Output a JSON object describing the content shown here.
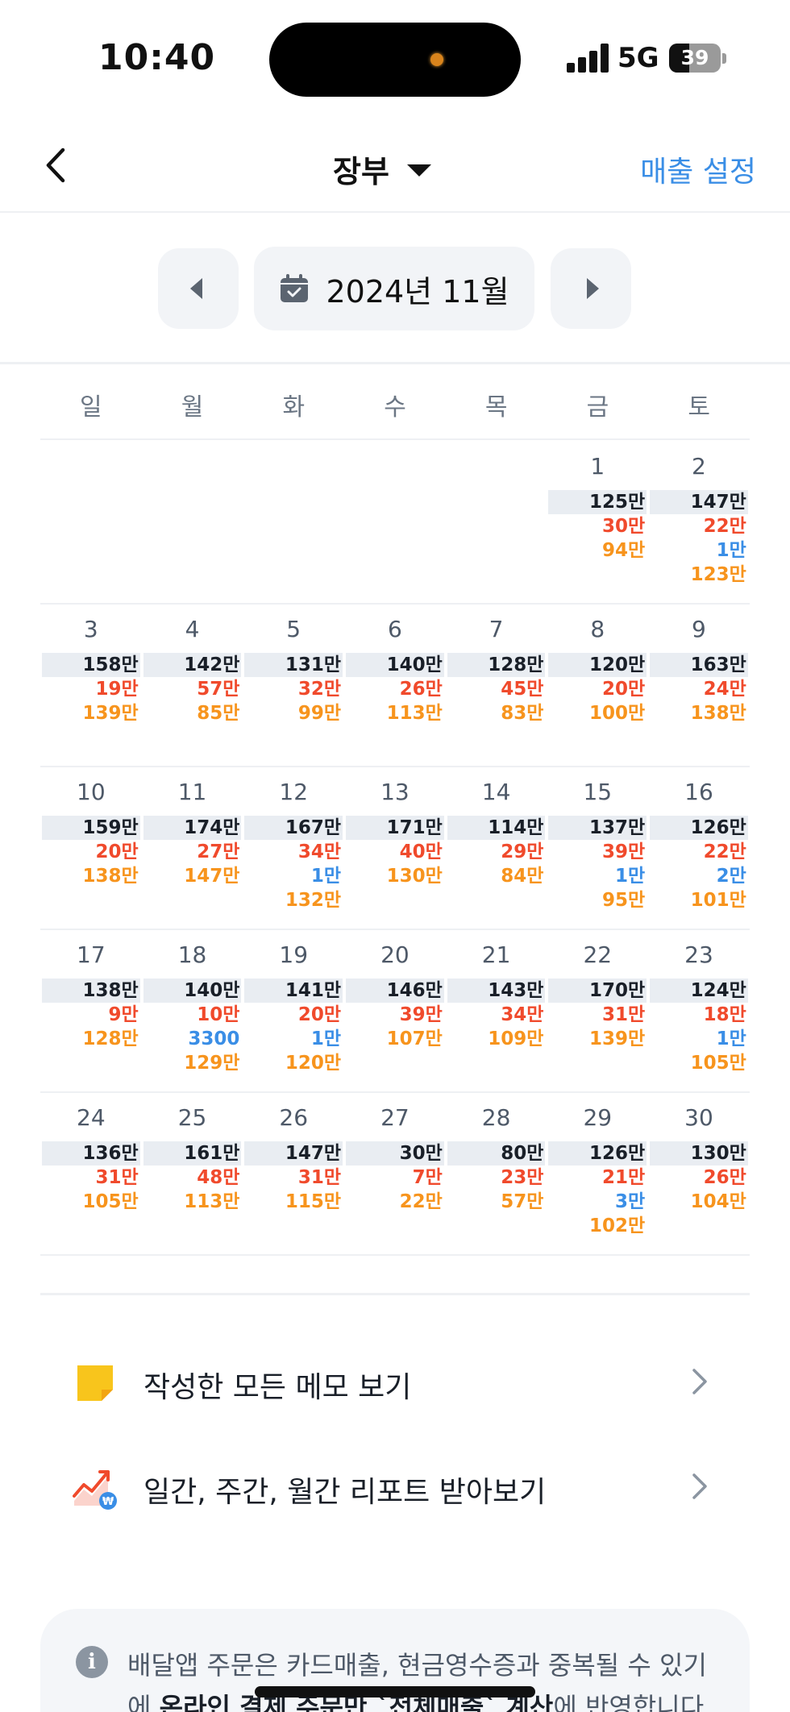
{
  "status_bar": {
    "time": "10:40",
    "network": "5G",
    "battery": "39",
    "battery_level": 0.39
  },
  "nav": {
    "title": "장부",
    "action": "매출 설정"
  },
  "month": {
    "label": "2024년 11월"
  },
  "weekdays": [
    "일",
    "월",
    "화",
    "수",
    "목",
    "금",
    "토"
  ],
  "weeks": [
    [
      null,
      null,
      null,
      null,
      null,
      {
        "day": "1",
        "values": [
          [
            "125만",
            "total"
          ],
          [
            "30만",
            "red"
          ],
          [
            "94만",
            "orange"
          ]
        ]
      },
      {
        "day": "2",
        "values": [
          [
            "147만",
            "total"
          ],
          [
            "22만",
            "red"
          ],
          [
            "1만",
            "blue"
          ],
          [
            "123만",
            "orange"
          ]
        ]
      }
    ],
    [
      {
        "day": "3",
        "values": [
          [
            "158만",
            "total"
          ],
          [
            "19만",
            "red"
          ],
          [
            "139만",
            "orange"
          ]
        ]
      },
      {
        "day": "4",
        "values": [
          [
            "142만",
            "total"
          ],
          [
            "57만",
            "red"
          ],
          [
            "85만",
            "orange"
          ]
        ]
      },
      {
        "day": "5",
        "values": [
          [
            "131만",
            "total"
          ],
          [
            "32만",
            "red"
          ],
          [
            "99만",
            "orange"
          ]
        ]
      },
      {
        "day": "6",
        "values": [
          [
            "140만",
            "total"
          ],
          [
            "26만",
            "red"
          ],
          [
            "113만",
            "orange"
          ]
        ]
      },
      {
        "day": "7",
        "values": [
          [
            "128만",
            "total"
          ],
          [
            "45만",
            "red"
          ],
          [
            "83만",
            "orange"
          ]
        ]
      },
      {
        "day": "8",
        "values": [
          [
            "120만",
            "total"
          ],
          [
            "20만",
            "red"
          ],
          [
            "100만",
            "orange"
          ]
        ]
      },
      {
        "day": "9",
        "values": [
          [
            "163만",
            "total"
          ],
          [
            "24만",
            "red"
          ],
          [
            "138만",
            "orange"
          ]
        ]
      }
    ],
    [
      {
        "day": "10",
        "values": [
          [
            "159만",
            "total"
          ],
          [
            "20만",
            "red"
          ],
          [
            "138만",
            "orange"
          ]
        ]
      },
      {
        "day": "11",
        "values": [
          [
            "174만",
            "total"
          ],
          [
            "27만",
            "red"
          ],
          [
            "147만",
            "orange"
          ]
        ]
      },
      {
        "day": "12",
        "values": [
          [
            "167만",
            "total"
          ],
          [
            "34만",
            "red"
          ],
          [
            "1만",
            "blue"
          ],
          [
            "132만",
            "orange"
          ]
        ]
      },
      {
        "day": "13",
        "values": [
          [
            "171만",
            "total"
          ],
          [
            "40만",
            "red"
          ],
          [
            "130만",
            "orange"
          ]
        ]
      },
      {
        "day": "14",
        "values": [
          [
            "114만",
            "total"
          ],
          [
            "29만",
            "red"
          ],
          [
            "84만",
            "orange"
          ]
        ]
      },
      {
        "day": "15",
        "values": [
          [
            "137만",
            "total"
          ],
          [
            "39만",
            "red"
          ],
          [
            "1만",
            "blue"
          ],
          [
            "95만",
            "orange"
          ]
        ]
      },
      {
        "day": "16",
        "values": [
          [
            "126만",
            "total"
          ],
          [
            "22만",
            "red"
          ],
          [
            "2만",
            "blue"
          ],
          [
            "101만",
            "orange"
          ]
        ]
      }
    ],
    [
      {
        "day": "17",
        "values": [
          [
            "138만",
            "total"
          ],
          [
            "9만",
            "red"
          ],
          [
            "128만",
            "orange"
          ]
        ]
      },
      {
        "day": "18",
        "values": [
          [
            "140만",
            "total"
          ],
          [
            "10만",
            "red"
          ],
          [
            "3300",
            "blue"
          ],
          [
            "129만",
            "orange"
          ]
        ]
      },
      {
        "day": "19",
        "values": [
          [
            "141만",
            "total"
          ],
          [
            "20만",
            "red"
          ],
          [
            "1만",
            "blue"
          ],
          [
            "120만",
            "orange"
          ]
        ]
      },
      {
        "day": "20",
        "values": [
          [
            "146만",
            "total"
          ],
          [
            "39만",
            "red"
          ],
          [
            "107만",
            "orange"
          ]
        ]
      },
      {
        "day": "21",
        "values": [
          [
            "143만",
            "total"
          ],
          [
            "34만",
            "red"
          ],
          [
            "109만",
            "orange"
          ]
        ]
      },
      {
        "day": "22",
        "values": [
          [
            "170만",
            "total"
          ],
          [
            "31만",
            "red"
          ],
          [
            "139만",
            "orange"
          ]
        ]
      },
      {
        "day": "23",
        "values": [
          [
            "124만",
            "total"
          ],
          [
            "18만",
            "red"
          ],
          [
            "1만",
            "blue"
          ],
          [
            "105만",
            "orange"
          ]
        ]
      }
    ],
    [
      {
        "day": "24",
        "values": [
          [
            "136만",
            "total"
          ],
          [
            "31만",
            "red"
          ],
          [
            "105만",
            "orange"
          ]
        ]
      },
      {
        "day": "25",
        "values": [
          [
            "161만",
            "total"
          ],
          [
            "48만",
            "red"
          ],
          [
            "113만",
            "orange"
          ]
        ]
      },
      {
        "day": "26",
        "values": [
          [
            "147만",
            "total"
          ],
          [
            "31만",
            "red"
          ],
          [
            "115만",
            "orange"
          ]
        ]
      },
      {
        "day": "27",
        "values": [
          [
            "30만",
            "total"
          ],
          [
            "7만",
            "red"
          ],
          [
            "22만",
            "orange"
          ]
        ]
      },
      {
        "day": "28",
        "values": [
          [
            "80만",
            "total"
          ],
          [
            "23만",
            "red"
          ],
          [
            "57만",
            "orange"
          ]
        ]
      },
      {
        "day": "29",
        "values": [
          [
            "126만",
            "total"
          ],
          [
            "21만",
            "red"
          ],
          [
            "3만",
            "blue"
          ],
          [
            "102만",
            "orange"
          ]
        ]
      },
      {
        "day": "30",
        "values": [
          [
            "130만",
            "total"
          ],
          [
            "26만",
            "red"
          ],
          [
            "104만",
            "orange"
          ]
        ]
      }
    ]
  ],
  "menu": {
    "memo_label": "작성한 모든 메모 보기",
    "report_label": "일간, 주간, 월간 리포트 받아보기"
  },
  "info": {
    "line1": "배달앱 주문은 카드매출, 현금영수증과 중복될 수 있기",
    "line2_prefix": "에 ",
    "line2_bold": "온라인 결제 주문만 `전체매출` 계산",
    "line2_suffix": "에 반영합니다."
  },
  "colors": {
    "accent": "#3a8ee6",
    "total_bg": "#e9edf2",
    "red": "#f04a2c",
    "blue": "#3a8ee6",
    "orange": "#f7941d"
  }
}
